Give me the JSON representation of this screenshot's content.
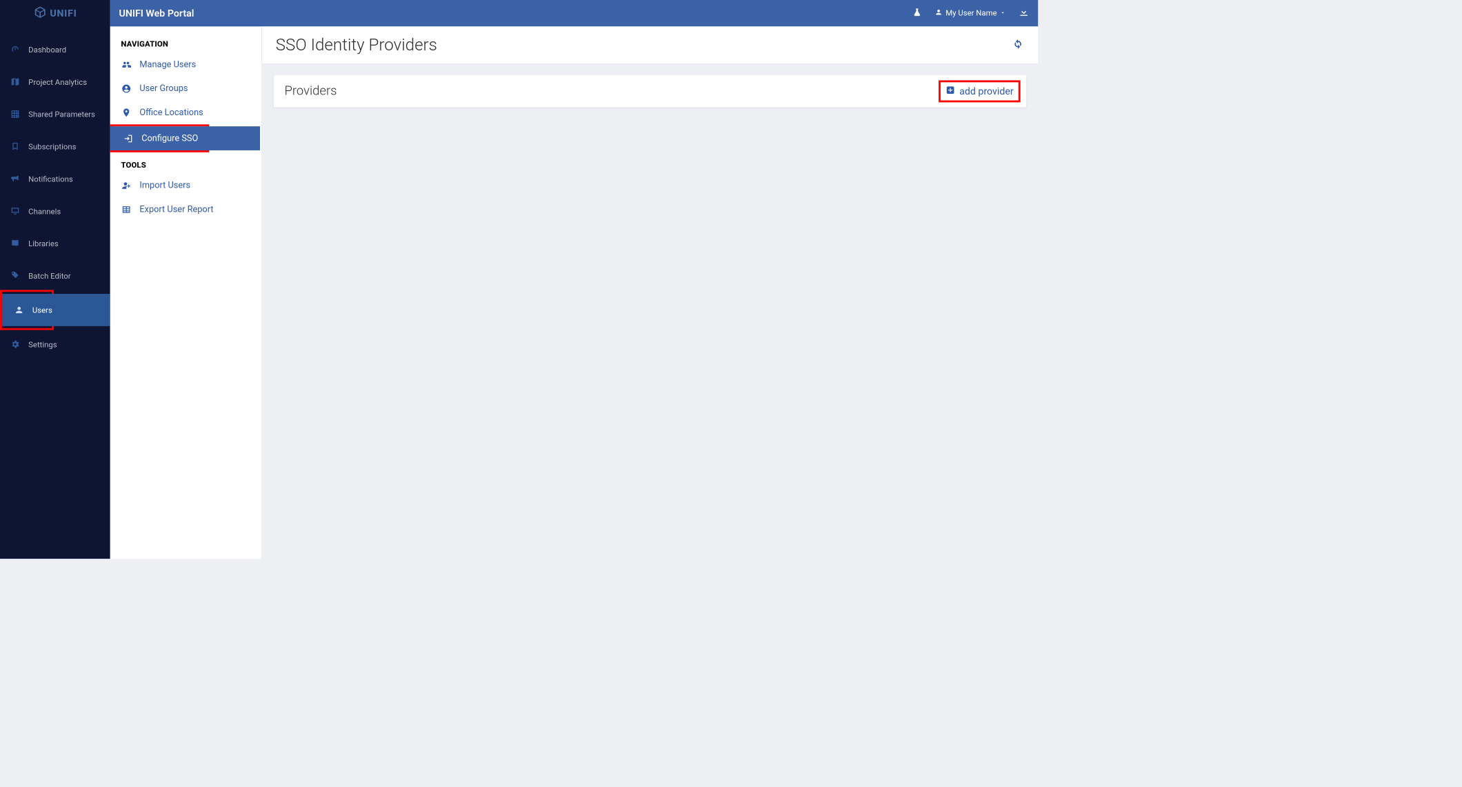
{
  "brand": {
    "name": "UNIFI"
  },
  "topbar": {
    "title": "UNIFI Web Portal",
    "user_label": "My User Name"
  },
  "sidebar": {
    "items": [
      {
        "label": "Dashboard",
        "icon": "speedometer-icon"
      },
      {
        "label": "Project Analytics",
        "icon": "map-icon"
      },
      {
        "label": "Shared Parameters",
        "icon": "grid-icon"
      },
      {
        "label": "Subscriptions",
        "icon": "bookmark-icon"
      },
      {
        "label": "Notifications",
        "icon": "bullhorn-icon"
      },
      {
        "label": "Channels",
        "icon": "monitor-icon"
      },
      {
        "label": "Libraries",
        "icon": "book-icon"
      },
      {
        "label": "Batch Editor",
        "icon": "tag-icon"
      },
      {
        "label": "Users",
        "icon": "user-icon",
        "active": true,
        "highlighted": true
      },
      {
        "label": "Settings",
        "icon": "gear-icon"
      }
    ]
  },
  "subnav": {
    "navigation_heading": "NAVIGATION",
    "navigation_items": [
      {
        "label": "Manage Users",
        "icon": "users-icon"
      },
      {
        "label": "User Groups",
        "icon": "circle-user-icon"
      },
      {
        "label": "Office Locations",
        "icon": "pin-icon"
      },
      {
        "label": "Configure SSO",
        "icon": "arrow-login-icon",
        "active": true,
        "highlighted": true
      }
    ],
    "tools_heading": "TOOLS",
    "tools_items": [
      {
        "label": "Import Users",
        "icon": "user-plus-icon"
      },
      {
        "label": "Export User Report",
        "icon": "table-icon"
      }
    ]
  },
  "main": {
    "page_title": "SSO Identity Providers",
    "panel_title": "Providers",
    "add_provider_label": "add provider",
    "add_provider_highlighted": true
  }
}
